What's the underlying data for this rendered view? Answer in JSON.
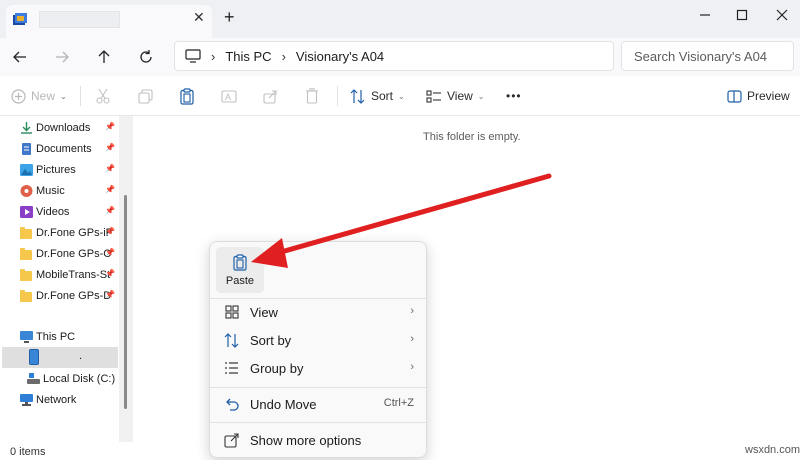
{
  "window": {
    "tab_close": "✕",
    "new_tab": "+"
  },
  "address": {
    "crumbs": [
      "This PC",
      "Visionary's A04"
    ],
    "search_placeholder": "Search Visionary's A04"
  },
  "toolbar": {
    "new_label": "New",
    "sort_label": "Sort",
    "view_label": "View",
    "more_label": "•••",
    "preview_label": "Preview"
  },
  "sidebar": {
    "quick_access": [
      {
        "label": "Downloads",
        "icon": "download-icon"
      },
      {
        "label": "Documents",
        "icon": "documents-icon"
      },
      {
        "label": "Pictures",
        "icon": "pictures-icon"
      },
      {
        "label": "Music",
        "icon": "music-icon"
      },
      {
        "label": "Videos",
        "icon": "videos-icon"
      },
      {
        "label": "Dr.Fone GPs-iF",
        "icon": "folder-icon"
      },
      {
        "label": "Dr.Fone GPs-C",
        "icon": "folder-icon"
      },
      {
        "label": "MobileTrans-St",
        "icon": "folder-icon"
      },
      {
        "label": "Dr.Fone GPs-D",
        "icon": "folder-icon"
      }
    ],
    "this_pc": "This PC",
    "device_label": ".",
    "local_disk": "Local Disk (C:)",
    "network": "Network"
  },
  "content": {
    "empty_message": "This folder is empty."
  },
  "status": {
    "items": "0 items"
  },
  "context_menu": {
    "paste": "Paste",
    "view": "View",
    "sort_by": "Sort by",
    "group_by": "Group by",
    "undo_move": "Undo Move",
    "undo_shortcut": "Ctrl+Z",
    "show_more": "Show more options"
  },
  "colors": {
    "accent": "#0067c0",
    "arrow": "#e02020"
  },
  "watermark": "wsxdn.com"
}
